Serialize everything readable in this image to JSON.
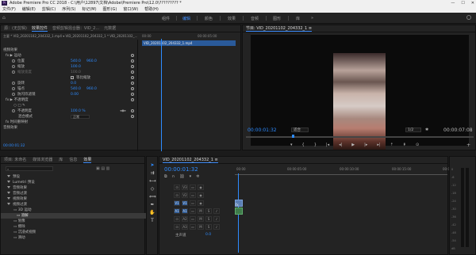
{
  "app": {
    "title": "Adobe Premiere Pro CC 2018 - C:\\用户\\12897\\文档\\Adobe\\Premiere Pro\\12.0\\????????? *",
    "minimize": "—",
    "maximize": "☐",
    "close": "✕"
  },
  "menu": [
    "文件(F)",
    "编辑(E)",
    "剪辑(C)",
    "序列(S)",
    "标记(M)",
    "图形(G)",
    "窗口(W)",
    "帮助(H)"
  ],
  "workspaces": {
    "items": [
      "组件",
      "编辑",
      "颜色",
      "效果",
      "音频",
      "图形",
      "库"
    ],
    "active_index": 1,
    "more": "»"
  },
  "source_panel": {
    "tabs": [
      "源：(无剪辑)",
      "效果控件",
      "音频剪辑混合器：VID_2...",
      "元数据"
    ],
    "active_tab": 1,
    "breadcrumb": "主要 * VID_20201102_204332_1.mp4 ▾ VID_20201102_204332_1 * VID_20201102_...",
    "mini_timecode": "00:00",
    "mini_timecode2": "00:00:05:00",
    "clip_name": "VID_20201102_204332_1.mp4",
    "section_video": "视频效果",
    "rows": [
      {
        "label": "fx ▶ 运动",
        "value": "",
        "value2": ""
      },
      {
        "label": "位置",
        "value": "540.0",
        "value2": "960.0"
      },
      {
        "label": "缩放",
        "value": "100.0",
        "value2": ""
      },
      {
        "label": "缩放宽度",
        "value": "100.0",
        "value2": ""
      },
      {
        "label": "等比缩放",
        "value": "✓",
        "value2": ""
      },
      {
        "label": "旋转",
        "value": "0.0",
        "value2": ""
      },
      {
        "label": "锚点",
        "value": "540.0",
        "value2": "960.0"
      },
      {
        "label": "防闪烁滤镜",
        "value": "0.00",
        "value2": ""
      },
      {
        "label": "fx ▶ 不透明度",
        "value": "",
        "value2": ""
      },
      {
        "label": "",
        "value": "",
        "value2": ""
      },
      {
        "label": "不透明度",
        "value": "100.0 %",
        "value2": ""
      },
      {
        "label": "混合模式",
        "value": "正常",
        "value2": ""
      },
      {
        "label": "fx 时间重映射",
        "value": "",
        "value2": ""
      },
      {
        "label": "音频效果",
        "value": "",
        "value2": ""
      }
    ],
    "footer_timecode": "00:00:01:32"
  },
  "program_panel": {
    "tab": "节目: VID_20201102_204332_1 ≡",
    "timecode": "00:00:01:32",
    "fit": "适合",
    "quality": "1/2",
    "duration": "00:00:07:08"
  },
  "project_panel": {
    "tabs": [
      "项目: 未命名",
      "媒体浏览器",
      "库",
      "信息",
      "效果",
      "标记",
      "历史记录"
    ],
    "active_tab": 4,
    "search_placeholder": "",
    "search_value": "",
    "items": [
      {
        "label": "预设",
        "open": false,
        "highlight": false
      },
      {
        "label": "Lumetri 预设",
        "open": false,
        "highlight": false
      },
      {
        "label": "音频效果",
        "open": false,
        "highlight": false
      },
      {
        "label": "音频过渡",
        "open": false,
        "highlight": false
      },
      {
        "label": "视频效果",
        "open": false,
        "highlight": false
      },
      {
        "label": "视频过渡",
        "open": true,
        "highlight": false
      },
      {
        "label": "3D 运动",
        "open": false,
        "highlight": false
      },
      {
        "label": "溶解",
        "open": false,
        "highlight": true
      },
      {
        "label": "划像",
        "open": false,
        "highlight": false
      },
      {
        "label": "擦除",
        "open": false,
        "highlight": false
      },
      {
        "label": "沉浸式视频",
        "open": false,
        "highlight": false
      },
      {
        "label": "滑动",
        "open": false,
        "highlight": false
      }
    ]
  },
  "timeline": {
    "tab": "VID_20201102_204332_1 ≡",
    "timecode": "00:00:01:32",
    "ruler": [
      "00:00",
      "00:00:05:00",
      "00:00:10:00",
      "00:00:15:00",
      "00:00:20:00"
    ],
    "tracks": [
      "V3",
      "V2",
      "V1",
      "A1",
      "A2",
      "A3"
    ],
    "master": "主声道",
    "master_value": "0.0"
  },
  "meter": {
    "ticks": [
      "0",
      "-6",
      "-12",
      "-18",
      "-24",
      "-30",
      "-36",
      "-42",
      "-48",
      "-54",
      "dB"
    ]
  },
  "colors": {
    "accent": "#2d8bff",
    "bg": "#1b1b1b",
    "panel": "#232323"
  }
}
